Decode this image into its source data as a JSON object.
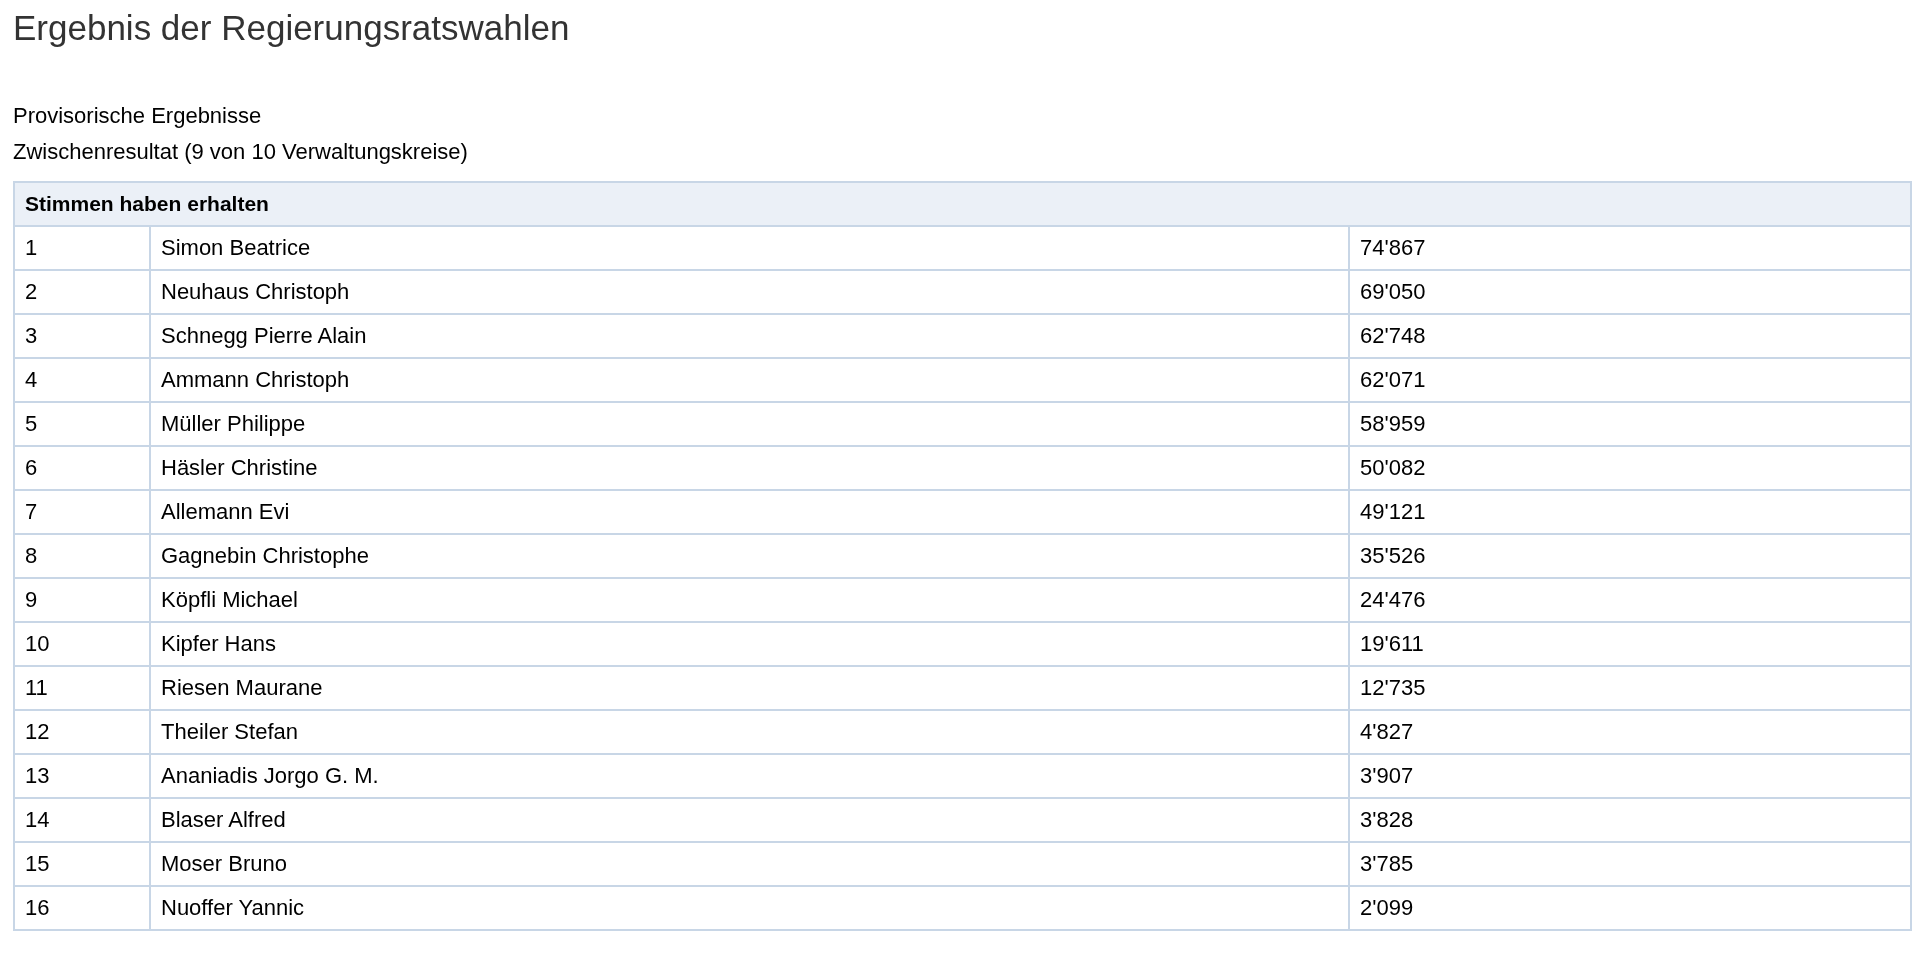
{
  "title": "Ergebnis der Regierungsratswahlen",
  "subtitles": [
    "Provisorische Ergebnisse",
    "Zwischenresultat (9 von 10 Verwaltungskreise)"
  ],
  "table": {
    "heading": "Stimmen haben erhalten",
    "rows": [
      {
        "rank": "1",
        "name": "Simon Beatrice",
        "votes": "74'867"
      },
      {
        "rank": "2",
        "name": "Neuhaus Christoph",
        "votes": "69'050"
      },
      {
        "rank": "3",
        "name": "Schnegg Pierre Alain",
        "votes": "62'748"
      },
      {
        "rank": "4",
        "name": "Ammann Christoph",
        "votes": "62'071"
      },
      {
        "rank": "5",
        "name": "Müller Philippe",
        "votes": "58'959"
      },
      {
        "rank": "6",
        "name": "Häsler Christine",
        "votes": "50'082"
      },
      {
        "rank": "7",
        "name": "Allemann Evi",
        "votes": "49'121"
      },
      {
        "rank": "8",
        "name": "Gagnebin Christophe",
        "votes": "35'526"
      },
      {
        "rank": "9",
        "name": "Köpfli Michael",
        "votes": "24'476"
      },
      {
        "rank": "10",
        "name": "Kipfer Hans",
        "votes": "19'611"
      },
      {
        "rank": "11",
        "name": "Riesen Maurane",
        "votes": "12'735"
      },
      {
        "rank": "12",
        "name": "Theiler Stefan",
        "votes": "4'827"
      },
      {
        "rank": "13",
        "name": "Ananiadis Jorgo G. M.",
        "votes": "3'907"
      },
      {
        "rank": "14",
        "name": "Blaser Alfred",
        "votes": "3'828"
      },
      {
        "rank": "15",
        "name": "Moser Bruno",
        "votes": "3'785"
      },
      {
        "rank": "16",
        "name": "Nuoffer Yannic",
        "votes": "2'099"
      }
    ]
  }
}
